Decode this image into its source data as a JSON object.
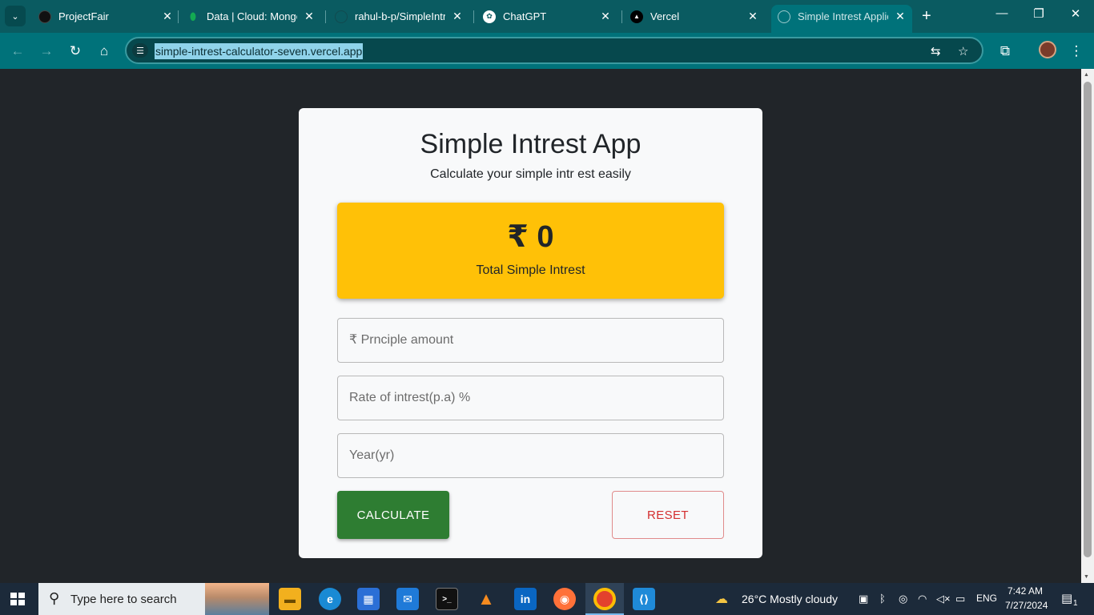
{
  "browser": {
    "tabs": [
      {
        "label": "ProjectFair",
        "icon": "projectfair-favicon",
        "color": "#1a1a1a"
      },
      {
        "label": "Data | Cloud: MongoDB",
        "icon": "mongodb-leaf-icon",
        "color": "#13aa52"
      },
      {
        "label": "rahul-b-p/SimpleIntrest",
        "icon": "github-icon",
        "color": "#0a5b61"
      },
      {
        "label": "ChatGPT",
        "icon": "chatgpt-icon",
        "color": "#ffffff"
      },
      {
        "label": "Vercel",
        "icon": "vercel-triangle-icon",
        "color": "#000000"
      },
      {
        "label": "Simple Intrest Application",
        "icon": "globe-icon",
        "color": "#6fb3b7"
      }
    ],
    "url": "simple-intrest-calculator-seven.vercel.app"
  },
  "app": {
    "title": "Simple Intrest App",
    "subtitle": "Calculate your simple intr est easily",
    "result": {
      "amount": "₹ 0",
      "label": "Total Simple Intrest"
    },
    "fields": {
      "principle_placeholder": "₹ Prnciple amount",
      "rate_placeholder": "Rate of intrest(p.a) %",
      "year_placeholder": "Year(yr)"
    },
    "buttons": {
      "calculate": "CALCULATE",
      "reset": "RESET"
    },
    "colors": {
      "result_bg": "#ffc107",
      "calculate_bg": "#2e7d32",
      "reset_text": "#d32f2f",
      "page_bg": "#212529"
    }
  },
  "taskbar": {
    "search_placeholder": "Type here to search",
    "apps": [
      "file-explorer-icon",
      "edge-icon",
      "store-icon",
      "mail-icon",
      "terminal-icon",
      "vlc-icon",
      "linkedin-icon",
      "firefox-icon",
      "chrome-icon",
      "vscode-icon"
    ],
    "weather": "26°C  Mostly cloudy",
    "language": "ENG",
    "time": "7:42 AM",
    "date": "7/27/2024",
    "notification_count": "1"
  }
}
